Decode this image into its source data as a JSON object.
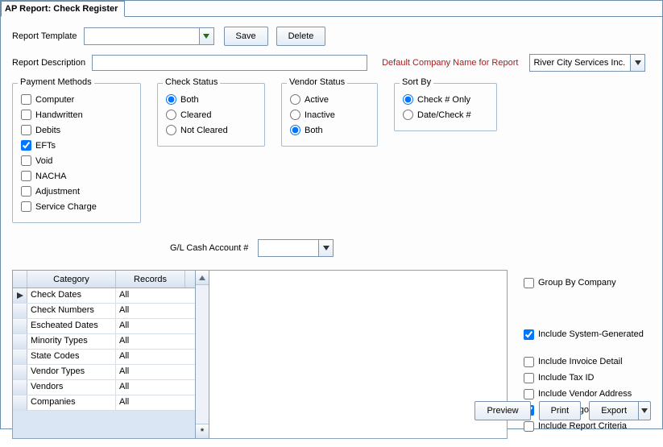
{
  "tab_title": "AP Report: Check Register",
  "row1": {
    "template_label": "Report Template",
    "save": "Save",
    "delete": "Delete"
  },
  "row2": {
    "desc_label": "Report Description",
    "company_label": "Default Company Name for Report",
    "company_value": "River City Services Inc."
  },
  "pm": {
    "title": "Payment Methods",
    "items": [
      {
        "label": "Computer",
        "checked": false
      },
      {
        "label": "Handwritten",
        "checked": false
      },
      {
        "label": "Debits",
        "checked": false
      },
      {
        "label": "EFTs",
        "checked": true
      },
      {
        "label": "Void",
        "checked": false
      },
      {
        "label": "NACHA",
        "checked": false
      },
      {
        "label": "Adjustment",
        "checked": false
      },
      {
        "label": "Service Charge",
        "checked": false
      }
    ]
  },
  "cs": {
    "title": "Check Status",
    "items": [
      {
        "label": "Both",
        "checked": true
      },
      {
        "label": "Cleared",
        "checked": false
      },
      {
        "label": "Not Cleared",
        "checked": false
      }
    ]
  },
  "vs": {
    "title": "Vendor Status",
    "items": [
      {
        "label": "Active",
        "checked": false
      },
      {
        "label": "Inactive",
        "checked": false
      },
      {
        "label": "Both",
        "checked": true
      }
    ]
  },
  "sb": {
    "title": "Sort By",
    "items": [
      {
        "label": "Check # Only",
        "checked": true
      },
      {
        "label": "Date/Check #",
        "checked": false
      }
    ]
  },
  "gl_label": "G/L Cash Account #",
  "grid": {
    "h1": "Category",
    "h2": "Records",
    "rows": [
      {
        "cat": "Check Dates",
        "rec": "All"
      },
      {
        "cat": "Check Numbers",
        "rec": "All"
      },
      {
        "cat": "Escheated Dates",
        "rec": "All"
      },
      {
        "cat": "Minority Types",
        "rec": "All"
      },
      {
        "cat": "State Codes",
        "rec": "All"
      },
      {
        "cat": "Vendor Types",
        "rec": "All"
      },
      {
        "cat": "Vendors",
        "rec": "All"
      },
      {
        "cat": "Companies",
        "rec": "All"
      }
    ],
    "new_marker": "*"
  },
  "opts": {
    "group_company": {
      "label": "Group By Company",
      "checked": false
    },
    "sys_gen": {
      "label": "Include System-Generated",
      "checked": true
    },
    "inv_detail": {
      "label": "Include Invoice Detail",
      "checked": false
    },
    "tax_id": {
      "label": "Include Tax ID",
      "checked": false
    },
    "vendor_addr": {
      "label": "Include Vendor Address",
      "checked": false
    },
    "logo": {
      "label": "Include Logo on Report",
      "checked": true
    },
    "criteria": {
      "label": "Include Report Criteria",
      "checked": false
    }
  },
  "footer": {
    "preview": "Preview",
    "print": "Print",
    "export": "Export"
  }
}
